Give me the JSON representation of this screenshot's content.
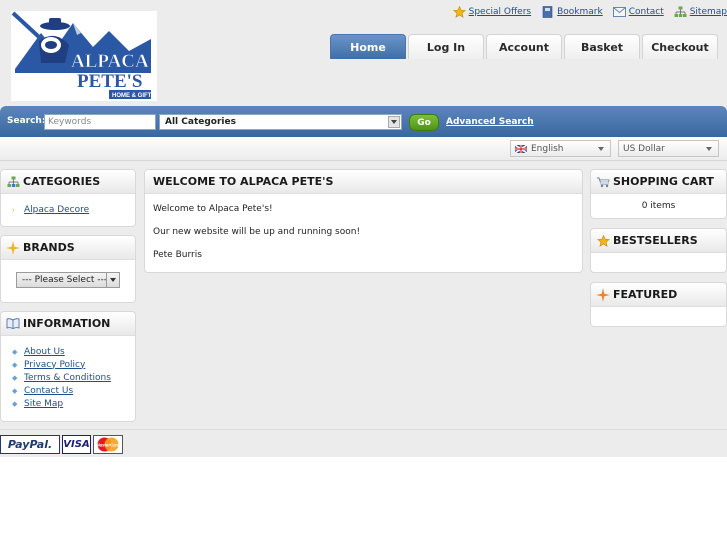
{
  "logo": {
    "line1": "ALPACA",
    "line2": "PETE'S",
    "tagline": "HOME & GIFT"
  },
  "top_links": [
    {
      "label": "Special Offers",
      "icon": "star-icon"
    },
    {
      "label": "Bookmark",
      "icon": "bookmark-icon"
    },
    {
      "label": "Contact",
      "icon": "mail-icon"
    },
    {
      "label": "Sitemap",
      "icon": "sitemap-icon"
    }
  ],
  "tabs": [
    {
      "label": "Home",
      "active": true
    },
    {
      "label": "Log In"
    },
    {
      "label": "Account"
    },
    {
      "label": "Basket"
    },
    {
      "label": "Checkout"
    }
  ],
  "search": {
    "label": "Search:",
    "placeholder": "Keywords",
    "category_value": "All Categories",
    "go_label": "Go",
    "advanced_label": "Advanced Search"
  },
  "language": {
    "value": "English"
  },
  "currency": {
    "value": "US Dollar"
  },
  "categories": {
    "title": "CATEGORIES",
    "items": [
      "Alpaca Decore"
    ]
  },
  "brands": {
    "title": "BRANDS",
    "select_value": "--- Please Select ---"
  },
  "information": {
    "title": "INFORMATION",
    "items": [
      "About Us",
      "Privacy Policy",
      "Terms & Conditions",
      "Contact Us",
      "Site Map"
    ]
  },
  "main": {
    "title": "WELCOME TO ALPACA PETE'S",
    "paragraphs": [
      "Welcome to Alpaca Pete's!",
      "Our new website will be up and running soon!",
      "Pete Burris"
    ]
  },
  "cart": {
    "title": "SHOPPING CART",
    "status": "0 items"
  },
  "bestsellers": {
    "title": "BESTSELLERS"
  },
  "featured": {
    "title": "FEATURED"
  },
  "footer": {
    "paypal_label": "PayPal.",
    "visa_label": "VISA",
    "mastercard_label": "MasterCard"
  },
  "colors": {
    "accent_blue": "#3f6da6",
    "link_blue": "#1d4f8c",
    "go_green": "#5fa323"
  }
}
